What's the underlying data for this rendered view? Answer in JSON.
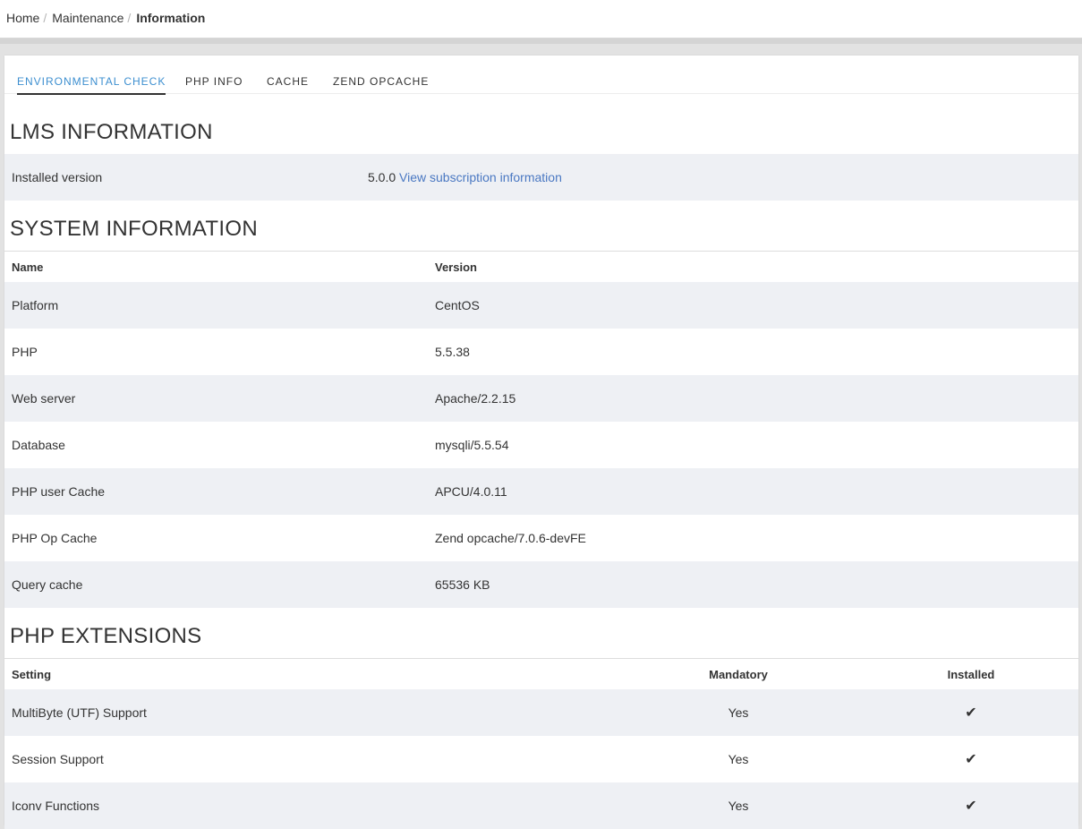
{
  "breadcrumb": {
    "home": "Home",
    "maintenance": "Maintenance",
    "current": "Information",
    "separator": "/"
  },
  "tabs": [
    {
      "label": "ENVIRONMENTAL CHECK",
      "active": true
    },
    {
      "label": "PHP INFO",
      "active": false
    },
    {
      "label": "CACHE",
      "active": false
    },
    {
      "label": "ZEND OPCACHE",
      "active": false
    }
  ],
  "lms": {
    "title": "LMS INFORMATION",
    "installed_label": "Installed version",
    "installed_value": "5.0.0",
    "subscription_link": "View subscription information"
  },
  "system": {
    "title": "SYSTEM INFORMATION",
    "col_name": "Name",
    "col_version": "Version",
    "rows": [
      {
        "name": "Platform",
        "version": "CentOS"
      },
      {
        "name": "PHP",
        "version": "5.5.38"
      },
      {
        "name": "Web server",
        "version": "Apache/2.2.15"
      },
      {
        "name": "Database",
        "version": "mysqli/5.5.54"
      },
      {
        "name": "PHP user Cache",
        "version": "APCU/4.0.11"
      },
      {
        "name": "PHP Op Cache",
        "version": "Zend opcache/7.0.6-devFE"
      },
      {
        "name": "Query cache",
        "version": "65536 KB"
      }
    ]
  },
  "extensions": {
    "title": "PHP EXTENSIONS",
    "col_setting": "Setting",
    "col_mandatory": "Mandatory",
    "col_installed": "Installed",
    "check_glyph": "✔",
    "rows": [
      {
        "setting": "MultiByte (UTF) Support",
        "mandatory": "Yes",
        "installed_icon": "check-icon"
      },
      {
        "setting": "Session Support",
        "mandatory": "Yes",
        "installed_icon": "check-icon"
      },
      {
        "setting": "Iconv Functions",
        "mandatory": "Yes",
        "installed_icon": "check-icon"
      }
    ]
  },
  "colors": {
    "accent": "#3d8fd0",
    "link": "#4a78c2",
    "row_alt": "#eef0f4"
  }
}
